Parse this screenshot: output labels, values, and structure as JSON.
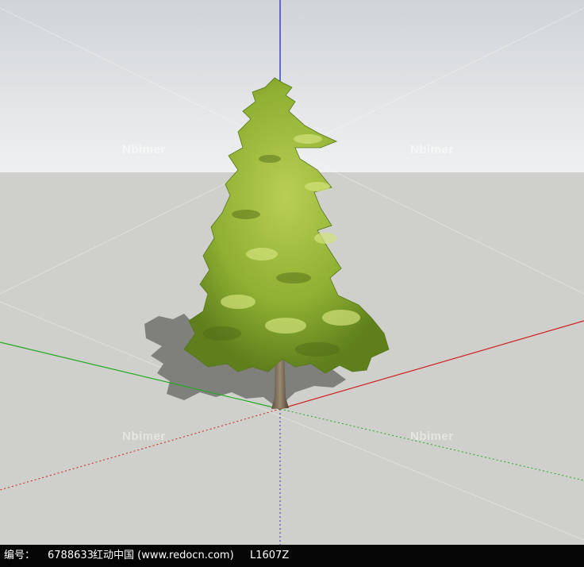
{
  "watermark": {
    "text": "Nbimer"
  },
  "footer": {
    "id_label": "编号：",
    "id_value": "6788633",
    "site": "红动中国 (www.redocn.com)",
    "code": "L1607Z"
  },
  "scene": {
    "sky_color_top": "#d2d6d9",
    "sky_color_bottom": "#eef0f1",
    "ground_color": "#cfcfcb",
    "axis_blue": "#1a1acc",
    "axis_red": "#cc2222",
    "axis_green": "#22aa22"
  }
}
